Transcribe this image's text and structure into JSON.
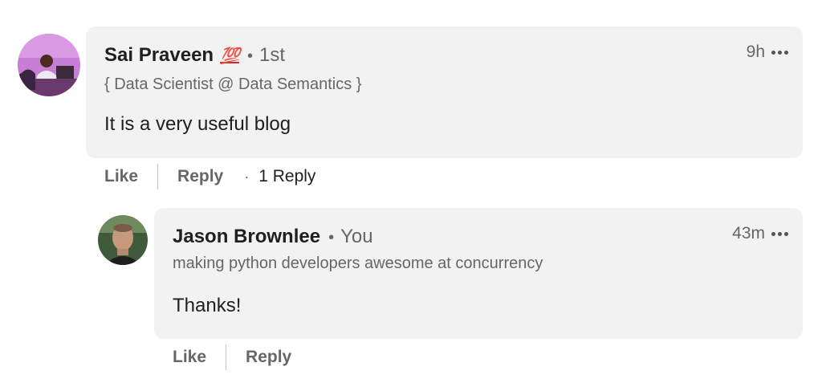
{
  "comments": [
    {
      "author": {
        "name": "Sai Praveen",
        "badge": "💯",
        "connection": "1st",
        "headline": "{ Data Scientist @ Data Semantics }"
      },
      "time": "9h",
      "text": "It is a very useful blog",
      "actions": {
        "like": "Like",
        "reply": "Reply",
        "reply_count": "1 Reply"
      }
    }
  ],
  "replies": [
    {
      "author": {
        "name": "Jason Brownlee",
        "connection": "You",
        "headline": "making python developers awesome at concurrency"
      },
      "time": "43m",
      "text": "Thanks!",
      "actions": {
        "like": "Like",
        "reply": "Reply"
      }
    }
  ],
  "colors": {
    "bubble_bg": "#f2f2f2",
    "text_primary": "#1f1f1f",
    "text_secondary": "#666666",
    "badge_red": "#d8262c"
  },
  "icons": {
    "overflow": "more-horizontal-icon",
    "avatar_1": "profile-photo-sai-praveen",
    "avatar_2": "profile-photo-jason-brownlee"
  }
}
